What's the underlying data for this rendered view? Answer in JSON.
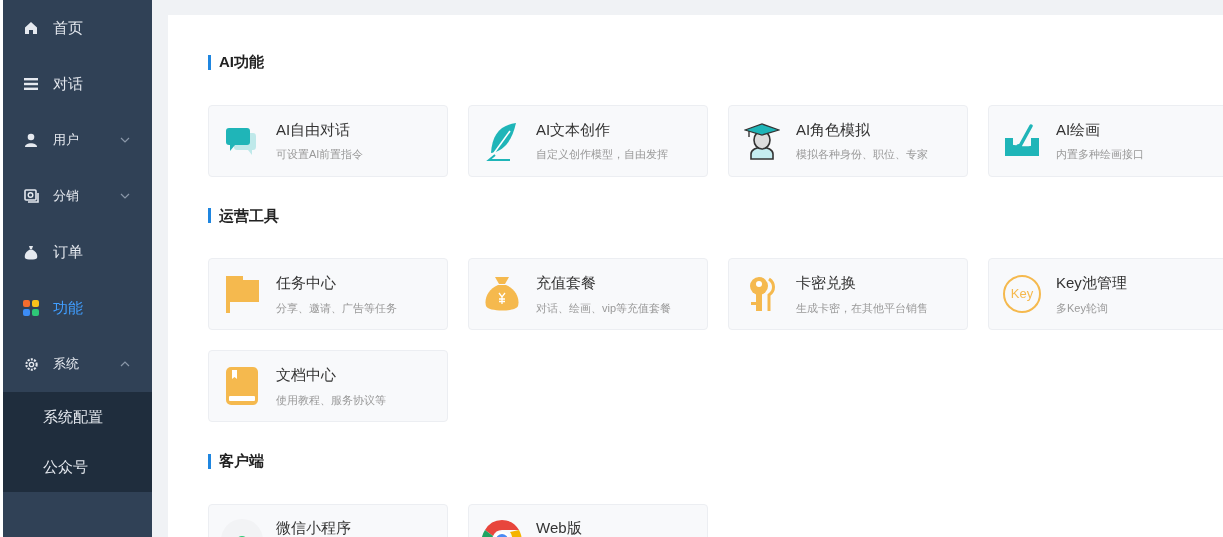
{
  "sidebar": {
    "items": [
      {
        "label": "首页",
        "selected": false
      },
      {
        "label": "对话",
        "selected": false
      },
      {
        "label": "用户",
        "selected": false,
        "expanded": false
      },
      {
        "label": "分销",
        "selected": false,
        "expanded": false
      },
      {
        "label": "订单",
        "selected": false
      },
      {
        "label": "功能",
        "selected": true
      },
      {
        "label": "系统",
        "selected": false,
        "expanded": true,
        "children": [
          {
            "label": "系统配置",
            "selected": false
          },
          {
            "label": "公众号",
            "selected": false
          }
        ]
      }
    ]
  },
  "sections": [
    {
      "title": "AI功能",
      "cards": [
        {
          "title": "AI自由对话",
          "description": "可设置AI前置指令"
        },
        {
          "title": "AI文本创作",
          "description": "自定义创作模型，自由发挥"
        },
        {
          "title": "AI角色模拟",
          "description": "模拟各种身份、职位、专家"
        },
        {
          "title": "AI绘画",
          "description": "内置多种绘画接口"
        }
      ]
    },
    {
      "title": "运营工具",
      "cards": [
        {
          "title": "任务中心",
          "description": "分享、邀请、广告等任务"
        },
        {
          "title": "充值套餐",
          "description": "对话、绘画、vip等充值套餐"
        },
        {
          "title": "卡密兑换",
          "description": "生成卡密，在其他平台销售"
        },
        {
          "title": "Key池管理",
          "description": "多Key轮询",
          "badge": "Key"
        },
        {
          "title": "文档中心",
          "description": "使用教程、服务协议等"
        }
      ]
    },
    {
      "title": "客户端",
      "cards": [
        {
          "title": "微信小程序"
        },
        {
          "title": "Web版"
        }
      ]
    }
  ]
}
